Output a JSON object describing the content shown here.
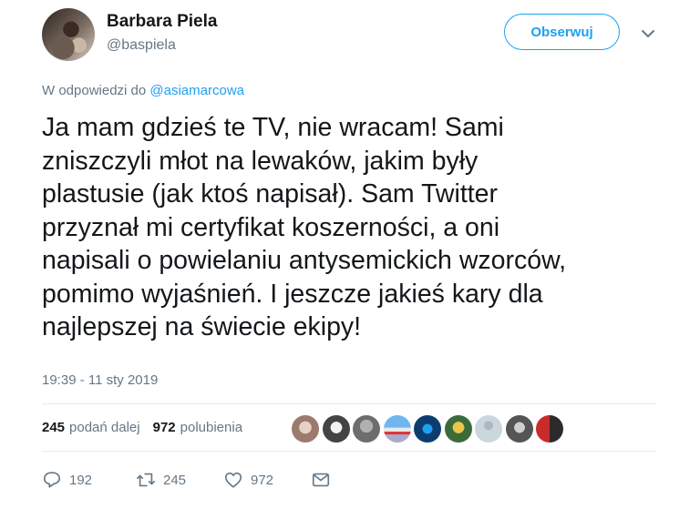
{
  "author": {
    "name": "Barbara Piela",
    "handle": "@baspiela"
  },
  "follow_label": "Obserwuj",
  "reply_prefix": "W odpowiedzi do",
  "reply_mention": "@asiamarcowa",
  "tweet_text": "Ja mam gdzieś te TV, nie wracam! Sami\nzniszczyli młot na lewaków, jakim były\nplastusie (jak ktoś napisał). Sam Twitter\nprzyznał mi certyfikat koszerności, a oni\nnapisali o powielaniu antysemickich wzorców,\npomimo wyjaśnień. I jeszcze jakieś kary dla\nnajlepszej na świecie ekipy!",
  "timestamp": "19:39 - 11 sty 2019",
  "stats": {
    "retweets_count": "245",
    "retweets_label": "podań dalej",
    "likes_count": "972",
    "likes_label": "polubienia"
  },
  "actions": {
    "reply_count": "192",
    "retweet_count": "245",
    "like_count": "972"
  },
  "icons": [
    "chevron-down-icon",
    "reply-icon",
    "retweet-icon",
    "heart-icon",
    "message-icon"
  ],
  "colors": {
    "accent": "#1da1f2",
    "text": "#14171a",
    "muted": "#657786",
    "divider": "#e6ecf0"
  }
}
